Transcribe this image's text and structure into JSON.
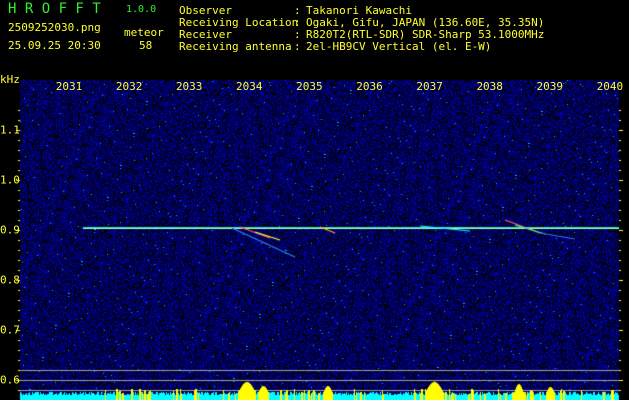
{
  "header": {
    "app_title": "H R O F F T",
    "version": "1.0.0",
    "filename": "2509252030.png",
    "datetime": "25.09.25 20:30",
    "meteor_label": "meteor",
    "meteor_count": "58",
    "info": [
      {
        "label": "Observer",
        "value": "Takanori Kawachi"
      },
      {
        "label": "Receiving Location",
        "value": "Ogaki, Gifu, JAPAN (136.60E, 35.35N)"
      },
      {
        "label": "Receiver",
        "value": "R820T2(RTL-SDR) SDR-Sharp 53.1000MHz"
      },
      {
        "label": "Receiving antenna",
        "value": "2el-HB9CV Vertical (el. E-W)"
      }
    ]
  },
  "spectrogram": {
    "y_unit": "kHz",
    "x_ticks": [
      "2031",
      "2032",
      "2033",
      "2034",
      "2035",
      "2036",
      "2037",
      "2038",
      "2039",
      "2040"
    ],
    "y_ticks": [
      "1.1",
      "1.0",
      "0.9",
      "0.8",
      "0.7",
      "0.6"
    ],
    "carrier_khz": 0.905,
    "colors": {
      "label": "#ffff33",
      "title": "#33ee33",
      "noise": "#0000c0",
      "level": "#00ffff",
      "meteor_bar": "#ffff00",
      "guide_line": "#a0a0a0"
    }
  }
}
